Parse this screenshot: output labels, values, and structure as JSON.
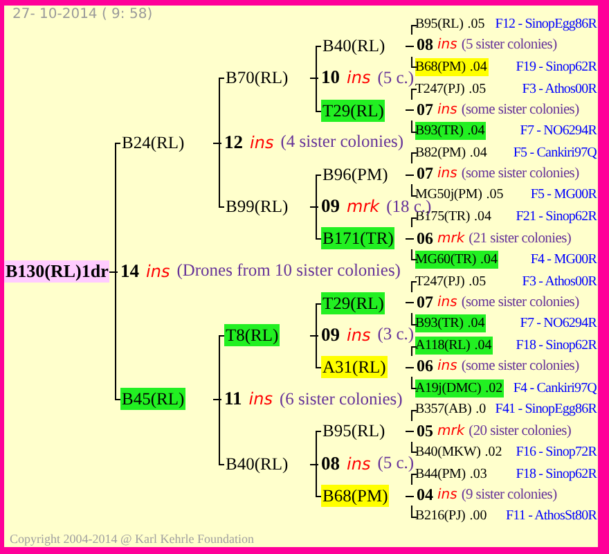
{
  "date": "27- 10-2014 ( 9: 58)",
  "tree": {
    "name": "B130(RL)1dr",
    "color": "#ffccff",
    "mating": {
      "count": "14",
      "kind": "ins",
      "note": "(Drones from 10 sister colonies)"
    },
    "parents": [
      {
        "name": "B24(RL)",
        "mating": {
          "count": "12",
          "kind": "ins",
          "note": "(4 sister colonies)"
        },
        "parents": [
          {
            "name": "B70(RL)",
            "mating": {
              "count": "10",
              "kind": "ins",
              "note": "(5 c.)"
            },
            "parents": [
              {
                "name": "B40(RL)",
                "mating": {
                  "count": "08",
                  "kind": "ins",
                  "note": "(5 sister colonies)"
                },
                "parents": [
                  {
                    "name": "B95(RL)",
                    "value": ".05",
                    "origin": "F12 - SinopEgg86R"
                  },
                  {
                    "name": "B68(PM)",
                    "value": ".04",
                    "origin": "F19 - Sinop62R",
                    "color": "#ffff00"
                  }
                ]
              },
              {
                "name": "T29(RL)",
                "color": "#22f022",
                "mating": {
                  "count": "07",
                  "kind": "ins",
                  "note": "(some sister colonies)"
                },
                "parents": [
                  {
                    "name": "T247(PJ)",
                    "value": ".05",
                    "origin": "F3 - Athos00R"
                  },
                  {
                    "name": "B93(TR)",
                    "value": ".04",
                    "origin": "F7 - NO6294R",
                    "color": "#22f022"
                  }
                ]
              }
            ]
          },
          {
            "name": "B99(RL)",
            "mating": {
              "count": "09",
              "kind": "mrk",
              "note": "(18 c.)"
            },
            "parents": [
              {
                "name": "B96(PM)",
                "mating": {
                  "count": "07",
                  "kind": "ins",
                  "note": "(some sister colonies)"
                },
                "parents": [
                  {
                    "name": "B82(PM)",
                    "value": ".04",
                    "origin": "F5 - Cankiri97Q"
                  },
                  {
                    "name": "MG50j(PM)",
                    "value": ".05",
                    "origin": "F5 - MG00R"
                  }
                ]
              },
              {
                "name": "B171(TR)",
                "color": "#22f022",
                "mating": {
                  "count": "06",
                  "kind": "mrk",
                  "note": "(21 sister colonies)"
                },
                "parents": [
                  {
                    "name": "B175(TR)",
                    "value": ".04",
                    "origin": "F21 - Sinop62R"
                  },
                  {
                    "name": "MG60(TR)",
                    "value": ".04",
                    "origin": "F4 - MG00R",
                    "color": "#22f022"
                  }
                ]
              }
            ]
          }
        ]
      },
      {
        "name": "B45(RL)",
        "color": "#22f022",
        "mating": {
          "count": "11",
          "kind": "ins",
          "note": "(6 sister colonies)"
        },
        "parents": [
          {
            "name": "T8(RL)",
            "color": "#22f022",
            "mating": {
              "count": "09",
              "kind": "ins",
              "note": "(3 c.)"
            },
            "parents": [
              {
                "name": "T29(RL)",
                "color": "#22f022",
                "mating": {
                  "count": "07",
                  "kind": "ins",
                  "note": "(some sister colonies)"
                },
                "parents": [
                  {
                    "name": "T247(PJ)",
                    "value": ".05",
                    "origin": "F3 - Athos00R"
                  },
                  {
                    "name": "B93(TR)",
                    "value": ".04",
                    "origin": "F7 - NO6294R",
                    "color": "#22f022"
                  }
                ]
              },
              {
                "name": "A31(RL)",
                "color": "#ffff00",
                "mating": {
                  "count": "06",
                  "kind": "ins",
                  "note": "(some sister colonies)"
                },
                "parents": [
                  {
                    "name": "A118(RL)",
                    "value": ".04",
                    "origin": "F18 - Sinop62R",
                    "color": "#22f022"
                  },
                  {
                    "name": "A19j(DMC)",
                    "value": ".02",
                    "origin": "F4 - Cankiri97Q",
                    "color": "#22f022"
                  }
                ]
              }
            ]
          },
          {
            "name": "B40(RL)",
            "mating": {
              "count": "08",
              "kind": "ins",
              "note": "(5 c.)"
            },
            "parents": [
              {
                "name": "B95(RL)",
                "mating": {
                  "count": "05",
                  "kind": "mrk",
                  "note": "(20 sister colonies)"
                },
                "parents": [
                  {
                    "name": "B357(AB)",
                    "value": ".0",
                    "origin": "F41 - SinopEgg86R"
                  },
                  {
                    "name": "B40(MKW)",
                    "value": ".02",
                    "origin": "F16 - Sinop72R"
                  }
                ]
              },
              {
                "name": "B68(PM)",
                "color": "#ffff00",
                "mating": {
                  "count": "04",
                  "kind": "ins",
                  "note": "(9 sister colonies)"
                },
                "parents": [
                  {
                    "name": "B44(PM)",
                    "value": ".03",
                    "origin": "F18 - Sinop62R"
                  },
                  {
                    "name": "B216(PJ)",
                    "value": ".00",
                    "origin": "F11 - AthosSt80R"
                  }
                ]
              }
            ]
          }
        ]
      }
    ]
  },
  "copyright": "Copyright 2004-2014 @ Karl Kehrle Foundation"
}
